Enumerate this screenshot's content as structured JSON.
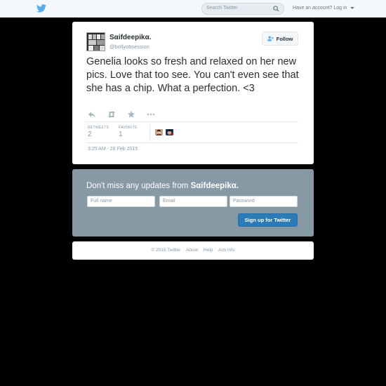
{
  "topbar": {
    "search_placeholder": "Search Twitter",
    "account_prompt": "Have an account?",
    "login_label": "Log in"
  },
  "tweet": {
    "display_name": "Sαifdeepikα.",
    "handle": "@bollyobsession",
    "follow_label": "Follow",
    "text": "Genelia looks so fresh and relaxed on her new pics. Love that too see. You can't even see that she has a chip. What a perfection. <3",
    "stats": {
      "retweets_label": "RETWEETS",
      "retweets_value": "2",
      "favorites_label": "FAVORITE",
      "favorites_value": "1"
    },
    "timestamp": "3:25 AM - 28 Feb 2015"
  },
  "signup": {
    "title_prefix": "Don't miss any updates from ",
    "title_name": "Sαifdeepikα.",
    "fullname_placeholder": "Full name",
    "email_placeholder": "Email",
    "password_placeholder": "Password",
    "button_label": "Sign up for Twitter"
  },
  "footer": {
    "links": [
      "© 2015 Twitter",
      "About",
      "Help",
      "Ads info"
    ]
  },
  "colors": {
    "brand_blue": "#55acee",
    "button_blue": "#2b7bb9",
    "signup_bg": "#8899a6"
  }
}
